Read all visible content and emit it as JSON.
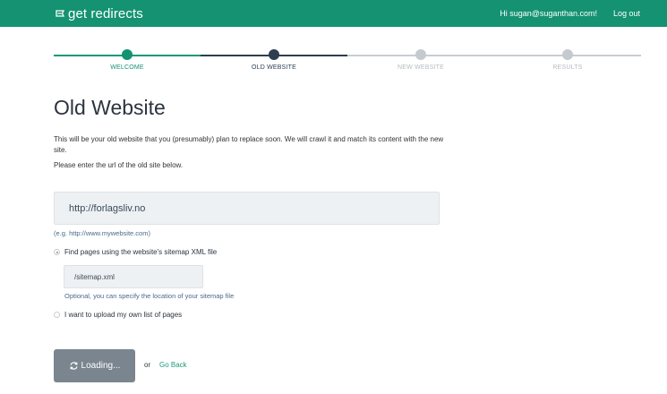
{
  "header": {
    "brand": "get redirects",
    "greeting": "Hi sugan@suganthan.com!",
    "logout_label": "Log out",
    "bg_color": "#149272"
  },
  "steps": [
    {
      "label": "WELCOME",
      "state": "done"
    },
    {
      "label": "OLD WEBSITE",
      "state": "current"
    },
    {
      "label": "NEW WEBSITE",
      "state": "pending"
    },
    {
      "label": "RESULTS",
      "state": "pending"
    }
  ],
  "main": {
    "title": "Old Website",
    "description": "This will be your old website that you (presumably) plan to replace soon. We will crawl it and match its content with the new site.",
    "instruction": "Please enter the url of the old site below.",
    "url_value": "http://forlagsliv.no",
    "url_hint": "(e.g. http://www.mywebsite.com)",
    "option_sitemap_label": "Find pages using the website's sitemap XML file",
    "sitemap_value": "/sitemap.xml",
    "sitemap_hint": "Optional, you can specify the location of your sitemap file",
    "option_upload_label": "I want to upload my own list of pages",
    "loading_label": "Loading...",
    "or_text": "or",
    "go_back_label": "Go Back"
  }
}
